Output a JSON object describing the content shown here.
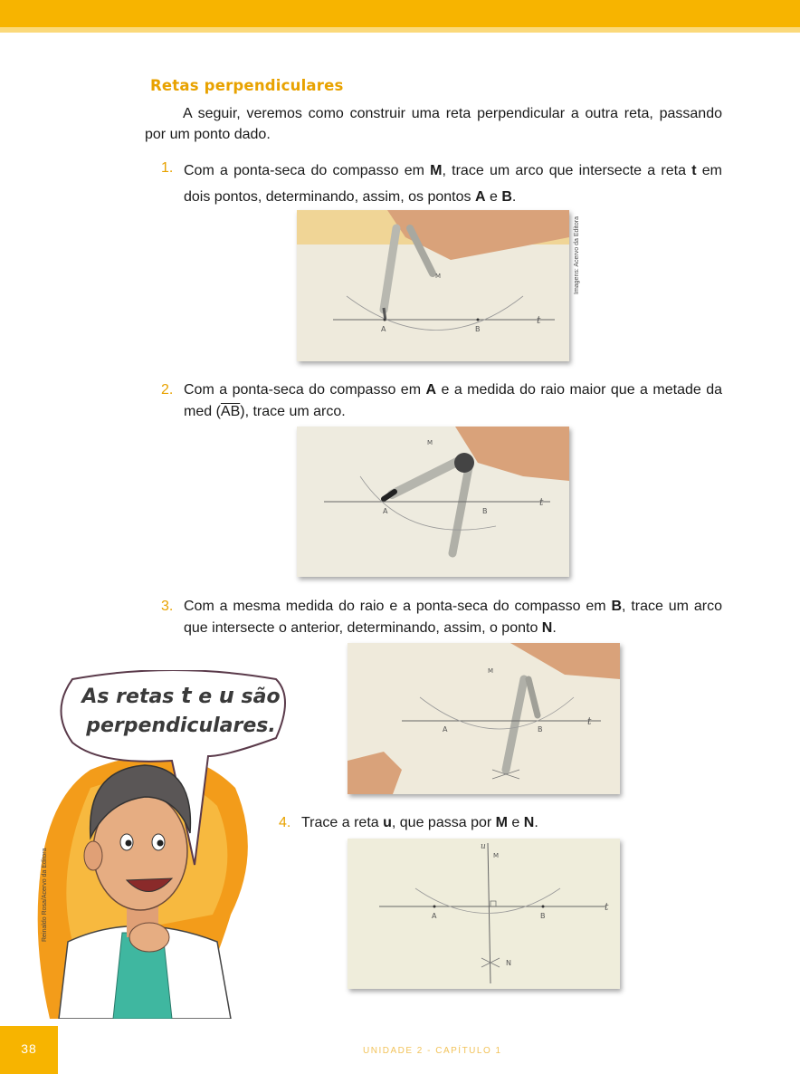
{
  "section": {
    "title": "Retas perpendiculares"
  },
  "intro": {
    "text": "A seguir, veremos como construir uma reta perpendicular a outra reta, passando por um ponto dado."
  },
  "steps": [
    {
      "num": "1.",
      "parts": [
        "Com a ponta-seca do compasso em ",
        "M",
        ", trace um arco que intersecte a reta ",
        "t",
        " em dois pontos, determinando, assim, os pontos ",
        "A",
        " e ",
        "B",
        "."
      ]
    },
    {
      "num": "2.",
      "parts": [
        "Com a ponta-seca do compasso em ",
        "A",
        " e a medida do raio maior que a metade da med (",
        "AB",
        "), trace um arco."
      ]
    },
    {
      "num": "3.",
      "parts": [
        "Com a mesma medida do raio e a ponta-seca do compasso em ",
        "B",
        ", trace um arco que intersecte o anterior, determinando, assim, o ponto ",
        "N",
        "."
      ]
    },
    {
      "num": "4.",
      "parts": [
        "Trace a reta ",
        "u",
        ", que passa por ",
        "M",
        " e ",
        "N",
        "."
      ]
    }
  ],
  "photo_labels": {
    "A": "A",
    "B": "B",
    "M": "M",
    "N": "N",
    "t": "t",
    "u": "u"
  },
  "credits": {
    "images": "Imagens: Acervo da Editora",
    "illustration": "Reinaldo Rosa/Acervo da Editora"
  },
  "speech_bubble": {
    "l1a": "As retas ",
    "t": "t",
    "l1b": " e ",
    "u": "u",
    "l1c": " são",
    "l2": "perpendiculares."
  },
  "footer": {
    "page_number": "38",
    "text": "UNIDADE 2  -  CAPÍTULO 1"
  },
  "colors": {
    "accent": "#f7b400",
    "accent_light": "#fbd97a",
    "title": "#e8a200"
  }
}
